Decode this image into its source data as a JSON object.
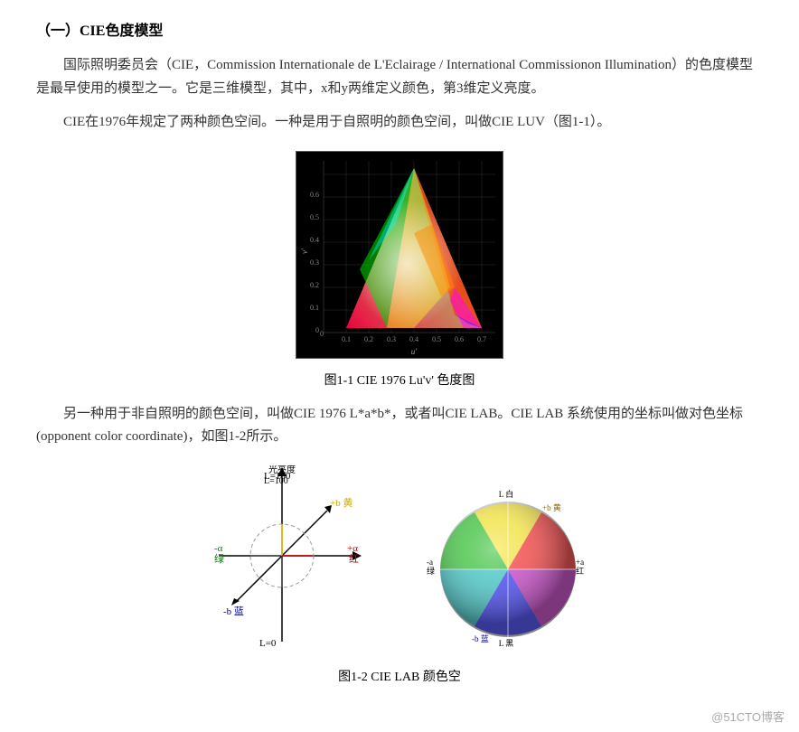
{
  "page": {
    "title": "（一）CIE色度模型",
    "paragraph1": "国际照明委员会（CIE，Commission Internationale de L'Eclairage / International Commissionon Illumination）的色度模型是最早使用的模型之一。它是三维模型，其中，x和y两维定义颜色，第3维定义亮度。",
    "paragraph2": "CIE在1976年规定了两种颜色空间。一种是用于自照明的颜色空间，叫做CIE LUV（图1-1）。",
    "figure1_caption": "图1-1   CIE 1976 Lu'v' 色度图",
    "paragraph3": "另一种用于非自照明的颜色空间，叫做CIE 1976 L*a*b*，或者叫CIE LAB。CIE LAB 系统使用的坐标叫做对色坐标(opponent color coordinate)，如图1-2所示。",
    "figure2_caption": "图1-2  CIE LAB 颜色空",
    "watermark": "@51CTO博客"
  }
}
